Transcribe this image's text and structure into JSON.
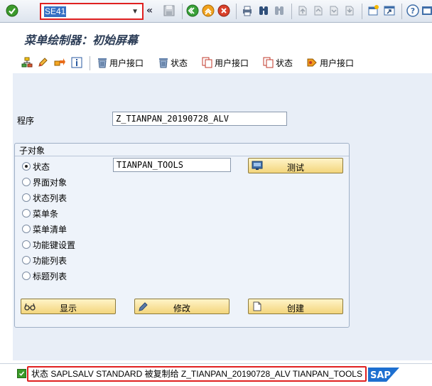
{
  "command_field": {
    "value": "SE41"
  },
  "screen_title": "菜单绘制器：初始屏幕",
  "app_toolbar": {
    "items": [
      {
        "icon": "hierarchy-icon",
        "label": ""
      },
      {
        "icon": "pencil-icon",
        "label": ""
      },
      {
        "icon": "move-icon",
        "label": ""
      },
      {
        "icon": "info-icon",
        "label": ""
      },
      {
        "icon": "interface-icon",
        "label": "用户接口"
      },
      {
        "icon": "interface-icon",
        "label": "状态"
      },
      {
        "icon": "copy-icon",
        "label": "用户接口"
      },
      {
        "icon": "copy-icon",
        "label": "状态"
      },
      {
        "icon": "transport-icon",
        "label": "用户接口"
      }
    ]
  },
  "program": {
    "label": "程序",
    "value": "Z_TIANPAN_20190728_ALV"
  },
  "subobjects": {
    "title": "子对象",
    "status_value": "TIANPAN_TOOLS",
    "options": [
      {
        "label": "状态",
        "selected": true
      },
      {
        "label": "界面对象",
        "selected": false
      },
      {
        "label": "状态列表",
        "selected": false
      },
      {
        "label": "菜单条",
        "selected": false
      },
      {
        "label": "菜单清单",
        "selected": false
      },
      {
        "label": "功能键设置",
        "selected": false
      },
      {
        "label": "功能列表",
        "selected": false
      },
      {
        "label": "标题列表",
        "selected": false
      }
    ],
    "test_button": "测试",
    "display_button": "显示",
    "change_button": "修改",
    "create_button": "创建"
  },
  "status_bar": {
    "type": "success",
    "message": "状态 SAPLSALV STANDARD 被复制给 Z_TIANPAN_20190728_ALV TIANPAN_TOOLS"
  },
  "colors": {
    "highlight_border": "#e02020",
    "sap_blue": "#1d6fd0",
    "button_gold": "#f3d57c",
    "content_bg": "#e8eef7"
  }
}
